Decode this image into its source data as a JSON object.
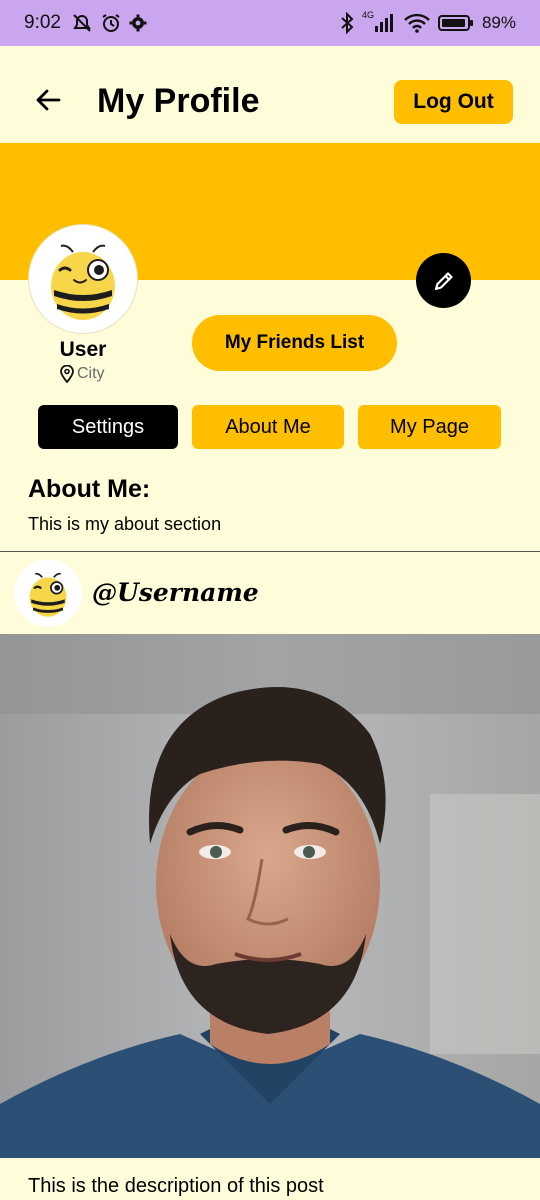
{
  "status_bar": {
    "time": "9:02",
    "network": "4G",
    "battery": "89%",
    "icons": [
      "muted-notifications-icon",
      "alarm-icon",
      "settings-gear-icon",
      "bluetooth-icon",
      "signal-icon",
      "wifi-icon",
      "battery-icon"
    ]
  },
  "header": {
    "title": "My Profile",
    "logout_label": "Log Out",
    "back_icon": "back-arrow-icon"
  },
  "profile": {
    "name": "User",
    "city": "City",
    "friends_button_label": "My Friends List",
    "edit_icon": "pencil-icon"
  },
  "tabs": [
    {
      "label": "Settings",
      "active": true
    },
    {
      "label": "About Me",
      "active": false
    },
    {
      "label": "My Page",
      "active": false
    }
  ],
  "about": {
    "heading": "About Me:",
    "text": "This is my about section"
  },
  "post": {
    "username": "@Username",
    "description": "This is the description of this post"
  },
  "colors": {
    "accent": "#ffbf00",
    "background": "#fffcd9",
    "status_bar": "#c9a6ee",
    "active_tab": "#000000"
  }
}
